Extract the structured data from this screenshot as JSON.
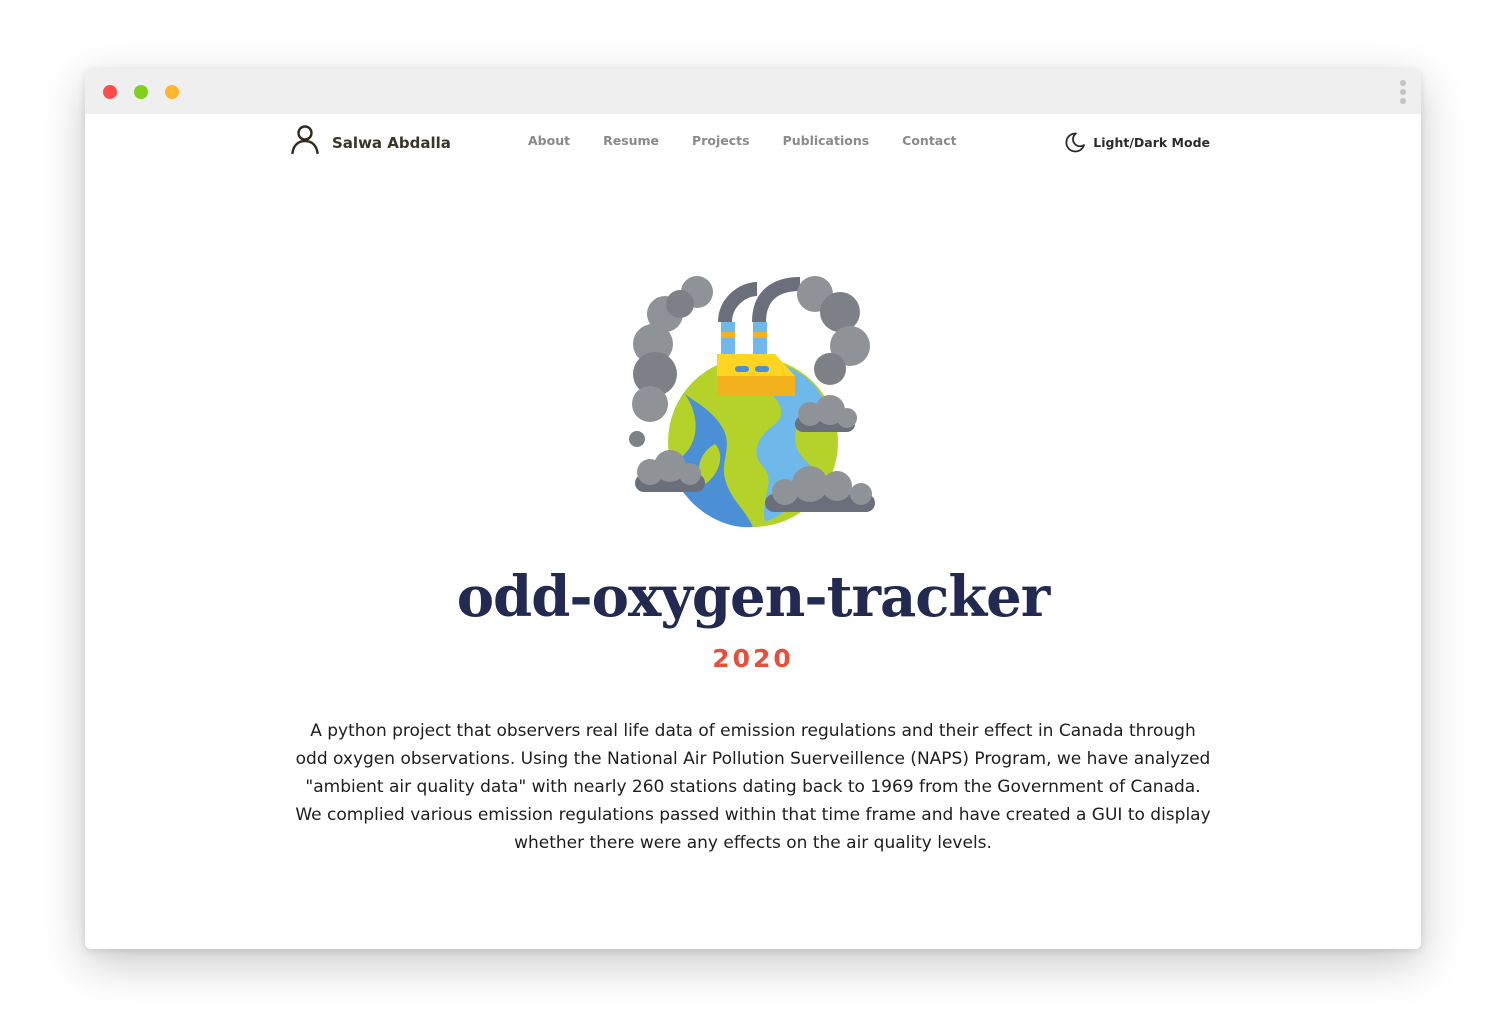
{
  "nav": {
    "brand_name": "Salwa Abdalla",
    "links": [
      "About",
      "Resume",
      "Projects",
      "Publications",
      "Contact"
    ],
    "mode_label": "Light/Dark Mode"
  },
  "project": {
    "title": "odd-oxygen-tracker",
    "year": "2020",
    "description": "A python project that observers real life data of emission regulations and their effect in Canada through odd oxygen observations. Using the National Air Pollution Suerveillence (NAPS) Program, we have analyzed \"ambient air quality data\" with nearly 260 stations dating back to 1969 from the Government of Canada. We complied various emission regulations passed within that time frame and have created a GUI to display whether there were any effects on the air quality levels.",
    "image_icon": "polluted-earth-icon"
  },
  "colors": {
    "title": "#222a52",
    "year": "#e5503c",
    "traffic_red": "#ff4b4b",
    "traffic_green": "#7fd11a",
    "traffic_yellow": "#ffb52e"
  }
}
